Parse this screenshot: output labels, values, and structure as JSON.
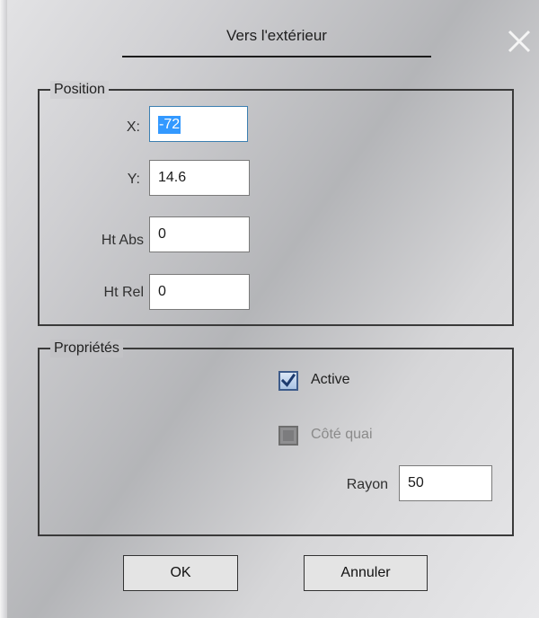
{
  "window": {
    "title": "Vers l'extérieur",
    "close_icon": "close-icon"
  },
  "position_group": {
    "legend": "Position",
    "fields": [
      {
        "label": "X:",
        "value": "-72",
        "selected": true
      },
      {
        "label": "Y:",
        "value": "14.6"
      },
      {
        "label": "Ht Abs",
        "value": "0"
      },
      {
        "label": "Ht Rel",
        "value": "0"
      }
    ]
  },
  "properties_group": {
    "legend": "Propriétés",
    "active": {
      "label": "Active",
      "checked": true,
      "enabled": true
    },
    "cote_quai": {
      "label": "Côté quai",
      "checked": false,
      "enabled": false
    },
    "rayon": {
      "label": "Rayon",
      "value": "50"
    }
  },
  "buttons": {
    "ok": "OK",
    "cancel": "Annuler"
  },
  "colors": {
    "selection": "#3399ff",
    "checkbox_accent": "#3d5b8a"
  }
}
